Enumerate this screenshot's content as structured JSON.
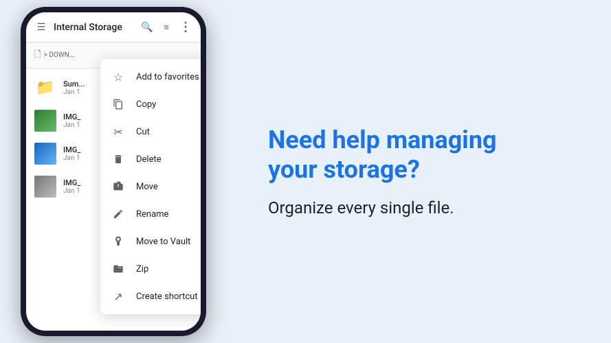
{
  "app": {
    "title": "Internal Storage",
    "breadcrumb": "> DOWN..."
  },
  "toolbar": {
    "search_icon": "🔍",
    "filter_icon": "≡",
    "more_icon": "⋮",
    "hamburger_icon": "☰"
  },
  "files": [
    {
      "name": "Sum...",
      "date": "Jan 1",
      "type": "folder"
    },
    {
      "name": "IMG_",
      "date": "Jan 1",
      "type": "image-green"
    },
    {
      "name": "IMG_",
      "date": "Jan 1",
      "type": "image-blue"
    },
    {
      "name": "IMG_",
      "date": "Jan 1",
      "type": "image-gray"
    }
  ],
  "context_menu": {
    "items": [
      {
        "label": "Add to favorites",
        "icon": "star"
      },
      {
        "label": "Copy",
        "icon": "copy"
      },
      {
        "label": "Cut",
        "icon": "cut"
      },
      {
        "label": "Delete",
        "icon": "delete"
      },
      {
        "label": "Move",
        "icon": "move"
      },
      {
        "label": "Rename",
        "icon": "rename"
      },
      {
        "label": "Move to Vault",
        "icon": "vault"
      },
      {
        "label": "Zip",
        "icon": "zip"
      },
      {
        "label": "Create shortcut",
        "icon": "shortcut"
      }
    ]
  },
  "promo": {
    "headline_line1": "Need help managing",
    "headline_line2": "your storage?",
    "subheadline": "Organize every single file."
  }
}
